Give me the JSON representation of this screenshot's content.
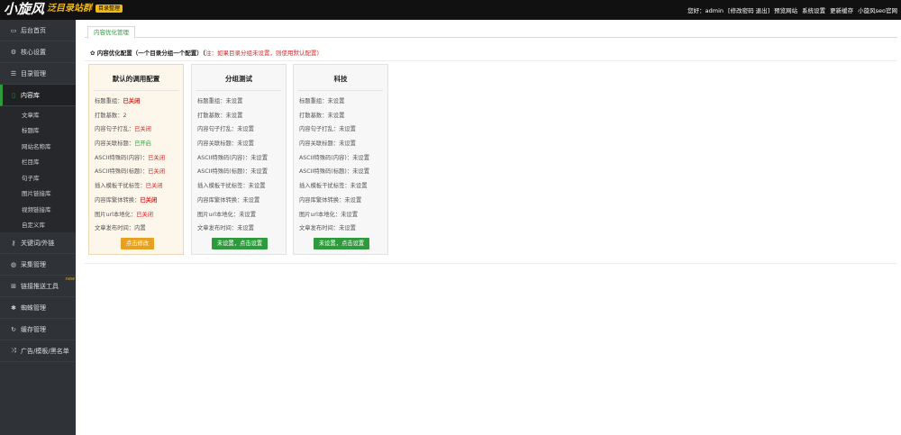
{
  "header": {
    "logo_main": "小旋风",
    "logo_sub": "泛目录站群",
    "logo_badge": "目录整理",
    "greeting": "您好：admin",
    "links": [
      "[修改密码",
      "退出]",
      "预览网站",
      "系统设置",
      "更新缓存",
      "小旋风seo官网"
    ]
  },
  "sidebar": {
    "items": [
      {
        "label": "后台首页",
        "icon": "monitor-icon"
      },
      {
        "label": "核心设置",
        "icon": "gear-icon"
      },
      {
        "label": "目录管理",
        "icon": "list-icon"
      },
      {
        "label": "内容库",
        "icon": "book-icon"
      }
    ],
    "sub_items": [
      "文章库",
      "标题库",
      "网站名称库",
      "栏目库",
      "句子库",
      "图片链接库",
      "视频链接库",
      "自定义库"
    ],
    "items_after": [
      {
        "label": "关键词/外链",
        "icon": "key-icon"
      },
      {
        "label": "采集管理",
        "icon": "globe-icon"
      },
      {
        "label": "链接推送工具",
        "icon": "link-icon",
        "badge": "new"
      },
      {
        "label": "蜘蛛管理",
        "icon": "spider-icon"
      },
      {
        "label": "缓存管理",
        "icon": "refresh-icon"
      },
      {
        "label": "广告/模板/黑名单",
        "icon": "shuffle-icon"
      }
    ]
  },
  "main": {
    "tab": "内容优化管理",
    "section_title": "内容优化配置（一个目录分组一个配置）（",
    "section_note": "注：如果目录分组未设置，则使用默认配置)",
    "cards": [
      {
        "title": "默认的调用配置",
        "rows": [
          {
            "label": "标题重组：",
            "value": "已关闭"
          },
          {
            "label": "打散基数：",
            "value": "2"
          },
          {
            "label": "内容句子打乱：",
            "value": "已关闭"
          },
          {
            "label": "内容关联标题：",
            "value": "已开启"
          },
          {
            "label": "ASCII特殊码(内容)：",
            "value": "已关闭"
          },
          {
            "label": "ASCII特殊码(标题)：",
            "value": "已关闭"
          },
          {
            "label": "插入模板干扰标签：",
            "value": "已关闭"
          },
          {
            "label": "内容库繁体转换：",
            "value": "已关闭"
          },
          {
            "label": "图片url本地化：",
            "value": "已关闭"
          },
          {
            "label": "文章发布时间：",
            "value": "内置"
          }
        ],
        "button": "点击修改"
      },
      {
        "title": "分组测试",
        "rows": [
          {
            "label": "标题重组：",
            "value": "未设置"
          },
          {
            "label": "打散基数：",
            "value": "未设置"
          },
          {
            "label": "内容句子打乱：",
            "value": "未设置"
          },
          {
            "label": "内容关联标题：",
            "value": "未设置"
          },
          {
            "label": "ASCII特殊码(内容)：",
            "value": "未设置"
          },
          {
            "label": "ASCII特殊码(标题)：",
            "value": "未设置"
          },
          {
            "label": "插入模板干扰标签：",
            "value": "未设置"
          },
          {
            "label": "内容库繁体转换：",
            "value": "未设置"
          },
          {
            "label": "图片url本地化：",
            "value": "未设置"
          },
          {
            "label": "文章发布时间：",
            "value": "未设置"
          }
        ],
        "button": "未设置，点击设置"
      },
      {
        "title": "科技",
        "rows": [
          {
            "label": "标题重组：",
            "value": "未设置"
          },
          {
            "label": "打散基数：",
            "value": "未设置"
          },
          {
            "label": "内容句子打乱：",
            "value": "未设置"
          },
          {
            "label": "内容关联标题：",
            "value": "未设置"
          },
          {
            "label": "ASCII特殊码(内容)：",
            "value": "未设置"
          },
          {
            "label": "ASCII特殊码(标题)：",
            "value": "未设置"
          },
          {
            "label": "插入模板干扰标签：",
            "value": "未设置"
          },
          {
            "label": "内容库繁体转换：",
            "value": "未设置"
          },
          {
            "label": "图片url本地化：",
            "value": "未设置"
          },
          {
            "label": "文章发布时间：",
            "value": "未设置"
          }
        ],
        "button": "未设置，点击设置"
      }
    ]
  },
  "colors": {
    "accent_green": "#2e9a3c",
    "accent_orange": "#e8a020",
    "status_red": "#d52a2a",
    "sidebar_bg": "#2f3237",
    "header_bg": "#111111"
  }
}
